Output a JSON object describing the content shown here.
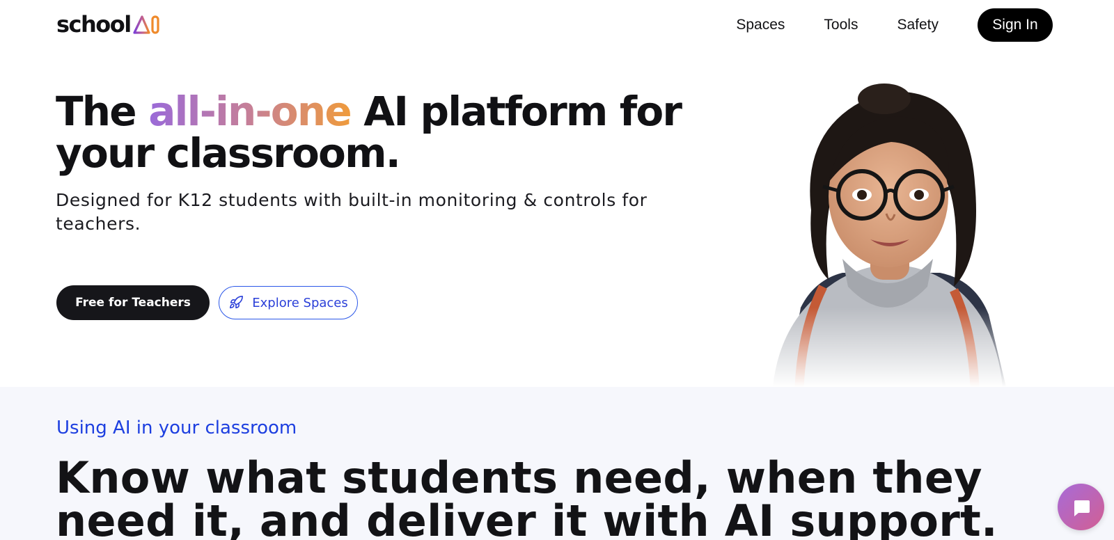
{
  "brand": {
    "logo_text": "school",
    "logo_mark": "AI",
    "colors": {
      "purple": "#7b3fd6",
      "orange": "#ef8a2b",
      "blue": "#1d3fe0",
      "dark": "#111114"
    }
  },
  "nav": {
    "links": [
      {
        "label": "Spaces"
      },
      {
        "label": "Tools"
      },
      {
        "label": "Safety"
      }
    ],
    "signin_label": "Sign In"
  },
  "hero": {
    "title_pre": "The ",
    "title_highlight": "all-in-one",
    "title_post_line1": " AI platform for",
    "title_line2": "your classroom.",
    "subtitle": "Designed for K12 students with built-in monitoring & controls for teachers.",
    "primary_cta": "Free for Teachers",
    "secondary_cta": "Explore Spaces",
    "secondary_icon": "rocket-icon",
    "illustration": "student-illustration"
  },
  "section": {
    "eyebrow": "Using AI in your classroom",
    "title": "Know what students need, when they need it, and deliver it with AI support."
  },
  "chat": {
    "icon": "chat-bubble-icon"
  }
}
